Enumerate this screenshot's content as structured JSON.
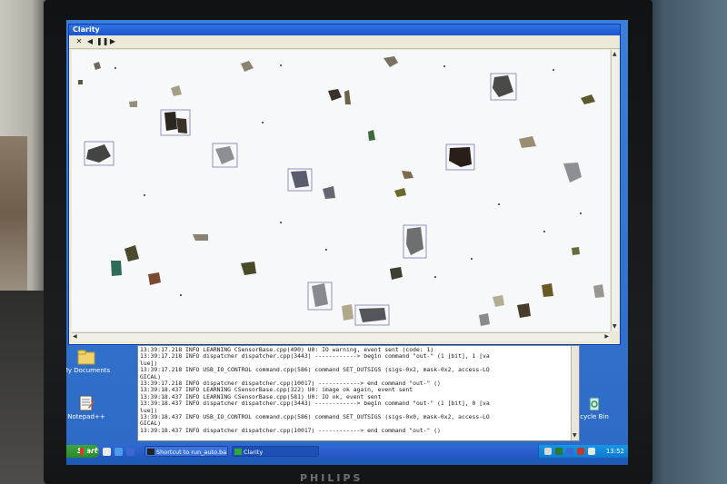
{
  "window": {
    "title": "Clarity",
    "toolbar": [
      "close",
      "back",
      "pause",
      "play"
    ]
  },
  "console": {
    "lines": [
      "13:39:17.218 INFO LEARNING CSensorBase.cpp(490) U0: IO warning, event sent (code: 1)",
      "13:39:17.218 INFO dispatcher dispatcher.cpp(3443) ------------> begin command \"out-\" (1 [bit], 1 [va",
      "lue])",
      "13:39:17.218 INFO USB_IO_CONTROL command.cpp(586) command SET_OUTSIGS (sigs-0x2, mask-0x2, access-LO",
      "GICAL)",
      "13:39:17.218 INFO dispatcher dispatcher.cpp(10017) ------------> end command \"out-\" ()",
      "13:39:18.437 INFO LEARNING CSensorBase.cpp(322) U0: image ok again, event sent",
      "13:39:18.437 INFO LEARNING CSensorBase.cpp(581) U0: IO ok, event sent",
      "13:39:18.437 INFO dispatcher dispatcher.cpp(3443) ------------> begin command \"out-\" (1 [bit], 0 [va",
      "lue])",
      "13:39:18.437 INFO USB_IO_CONTROL command.cpp(586) command SET_OUTSIGS (sigs-0x0, mask-0x2, access-LO",
      "GICAL)",
      "13:39:18.437 INFO dispatcher dispatcher.cpp(10017) ------------> end command \"out-\" ()"
    ]
  },
  "desktop_icons": {
    "my_documents": "My Documents",
    "notepad": "Notepad++",
    "recycle_bin": "cycle Bin"
  },
  "taskbar": {
    "start_label": "Start",
    "tasks": [
      "Shortcut to run_auto.ba...",
      "Clarity"
    ],
    "clock": "13:52"
  },
  "monitor": {
    "brand": "PHILIPS"
  },
  "colors": {
    "taskbar": "#2456c4",
    "start": "#2b8a2b",
    "titlebar": "#1c55cc",
    "canvas": "#f6f8f9"
  }
}
